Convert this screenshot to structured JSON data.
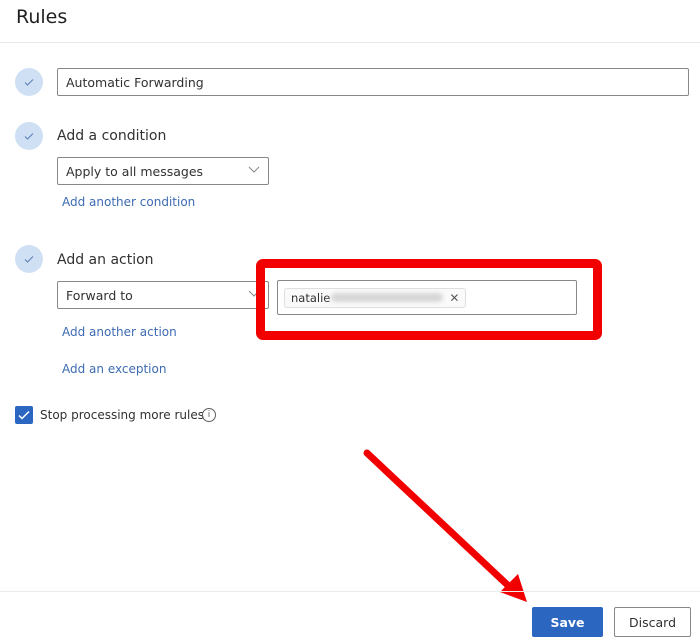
{
  "header": {
    "title": "Rules"
  },
  "rule_name": {
    "value": "Automatic Forwarding"
  },
  "condition": {
    "heading": "Add a condition",
    "selected": "Apply to all messages",
    "add_link": "Add another condition"
  },
  "action": {
    "heading": "Add an action",
    "selected": "Forward to",
    "recipient_visible": "natalie",
    "add_link": "Add another action"
  },
  "exception": {
    "add_link": "Add an exception"
  },
  "stop_processing": {
    "label": "Stop processing more rules",
    "checked": true
  },
  "footer": {
    "save_label": "Save",
    "discard_label": "Discard"
  },
  "colors": {
    "accent": "#2b66c0",
    "highlight": "#f20000",
    "step_circle": "#cfe0f5"
  },
  "annotations": {
    "highlight_box": "red rectangle around recipient field",
    "arrow": "red arrow pointing to Save"
  }
}
